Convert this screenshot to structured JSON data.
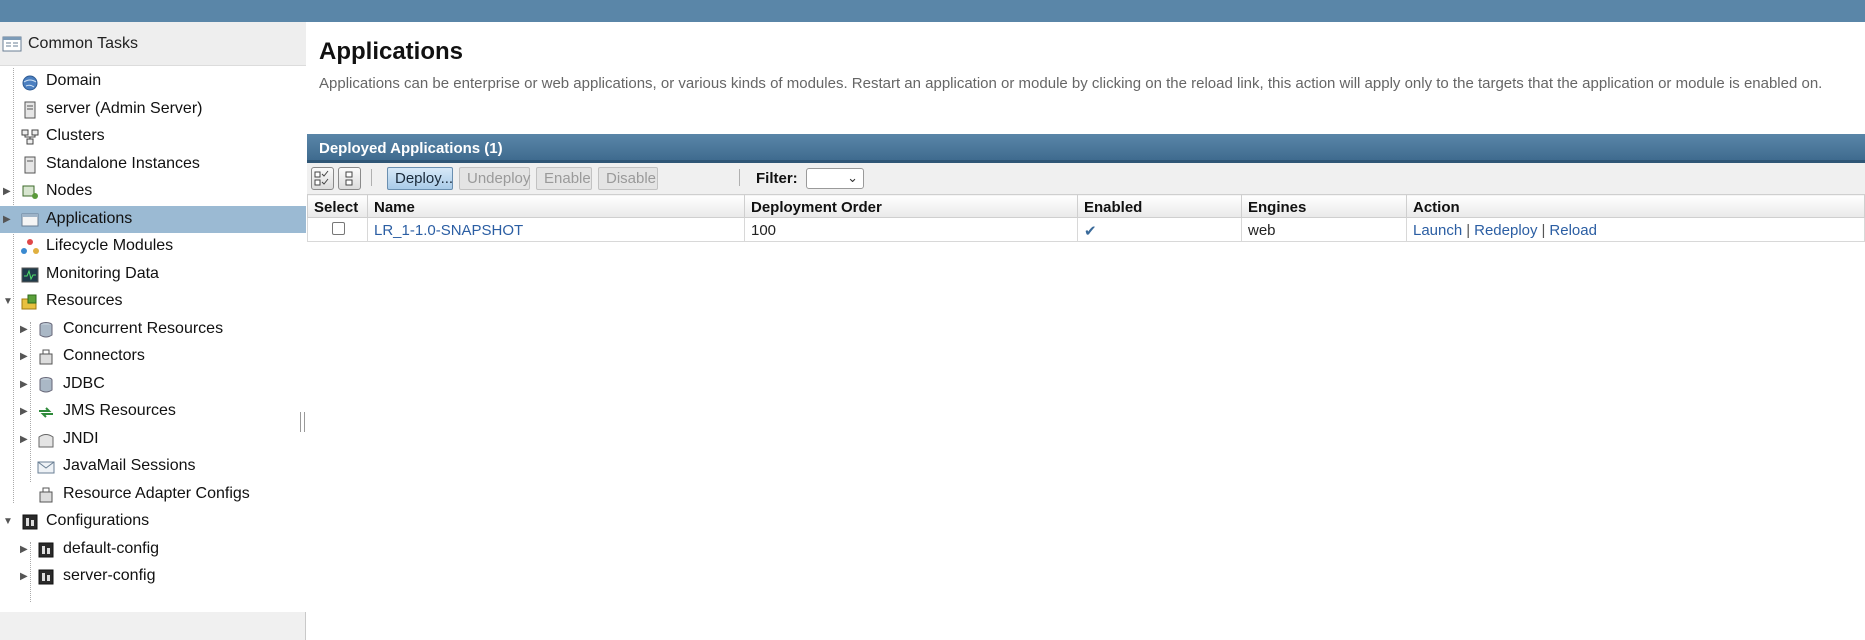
{
  "sidebar": {
    "header": "Common Tasks",
    "items": [
      {
        "label": "Domain",
        "icon": "globe-icon"
      },
      {
        "label": "server (Admin Server)",
        "icon": "server-icon"
      },
      {
        "label": "Clusters",
        "icon": "clusters-icon"
      },
      {
        "label": "Standalone Instances",
        "icon": "instance-icon"
      },
      {
        "label": "Nodes",
        "icon": "nodes-icon"
      },
      {
        "label": "Applications",
        "icon": "applications-icon"
      },
      {
        "label": "Lifecycle Modules",
        "icon": "lifecycle-icon"
      },
      {
        "label": "Monitoring Data",
        "icon": "monitoring-icon"
      },
      {
        "label": "Resources",
        "icon": "resources-icon"
      },
      {
        "label": "Concurrent Resources",
        "icon": "database-icon"
      },
      {
        "label": "Connectors",
        "icon": "connector-icon"
      },
      {
        "label": "JDBC",
        "icon": "database-icon"
      },
      {
        "label": "JMS Resources",
        "icon": "jms-icon"
      },
      {
        "label": "JNDI",
        "icon": "jndi-icon"
      },
      {
        "label": "JavaMail Sessions",
        "icon": "mail-icon"
      },
      {
        "label": "Resource Adapter Configs",
        "icon": "connector-icon"
      },
      {
        "label": "Configurations",
        "icon": "config-icon"
      },
      {
        "label": "default-config",
        "icon": "config-icon"
      },
      {
        "label": "server-config",
        "icon": "config-icon"
      }
    ]
  },
  "main": {
    "title": "Applications",
    "description": "Applications can be enterprise or web applications, or various kinds of modules. Restart an application or module by clicking on the reload link, this action will apply only to the targets that the application or module is enabled on."
  },
  "table": {
    "title": "Deployed Applications (1)",
    "buttons": {
      "deploy": "Deploy...",
      "undeploy": "Undeploy",
      "enable": "Enable",
      "disable": "Disable"
    },
    "filter_label": "Filter:",
    "filter_value": "",
    "columns": [
      "Select",
      "Name",
      "Deployment Order",
      "Enabled",
      "Engines",
      "Action"
    ],
    "rows": [
      {
        "name": "LR_1-1.0-SNAPSHOT",
        "deployment_order": "100",
        "enabled": true,
        "enabled_glyph": "✔",
        "engines": "web",
        "actions": {
          "launch": "Launch",
          "redeploy": "Redeploy",
          "reload": "Reload",
          "separator": "|"
        }
      }
    ]
  },
  "colors": {
    "topbar": "#5a86a8",
    "selected_row": "#9bbad3",
    "link": "#2b5ea3"
  }
}
